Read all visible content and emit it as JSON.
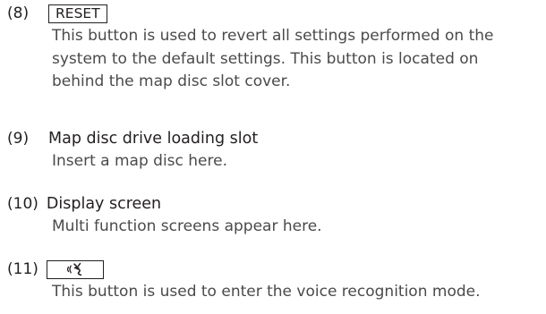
{
  "entries": [
    {
      "number": "(8)",
      "key_label": "RESET",
      "description": [
        "This button is used to revert all settings performed on the",
        "system to the default settings. This button is located on",
        "behind the map disc slot cover."
      ]
    },
    {
      "number": "(9)",
      "title": "Map disc drive loading slot",
      "description": [
        "Insert a map disc here."
      ]
    },
    {
      "number": "(10)",
      "title": "Display screen",
      "description": [
        "Multi function screens appear here."
      ]
    },
    {
      "number": "(11)",
      "key_icon": "voice-recognition-icon",
      "description": [
        "This button is used to enter the voice recognition mode."
      ]
    }
  ]
}
